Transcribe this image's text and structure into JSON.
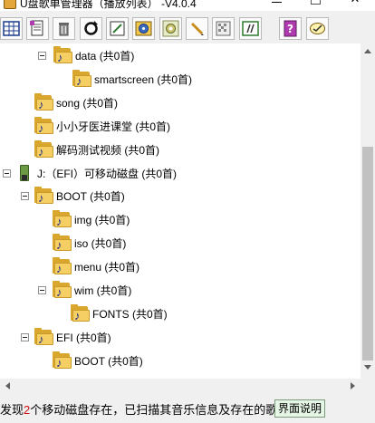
{
  "window": {
    "title": "U盘歌单管理器（播放列表）  -V4.0.4",
    "colors": {
      "folder": "#f5cf63",
      "note": "#1a2c8c",
      "status_highlight": "#d01010",
      "help_button_bg": "#e6f6e6"
    }
  },
  "toolbar": {
    "buttons": [
      {
        "icon": "grid-icon"
      },
      {
        "icon": "playlist-icon"
      },
      {
        "icon": "trash-icon"
      },
      {
        "icon": "refresh-icon"
      },
      {
        "icon": "edit-icon"
      },
      {
        "icon": "disc-icon"
      },
      {
        "icon": "settings-icon"
      },
      {
        "icon": "pen-icon"
      },
      {
        "icon": "pattern-icon"
      },
      {
        "icon": "format-icon"
      },
      {
        "icon": "help-icon"
      },
      {
        "icon": "about-icon"
      }
    ]
  },
  "tree": {
    "items": [
      {
        "label": "data  (共0首)",
        "expanded": true
      },
      {
        "label": "smartscreen  (共0首)"
      },
      {
        "label": "song  (共0首)"
      },
      {
        "label": "小小牙医进课堂  (共0首)"
      },
      {
        "label": "解码测试视频  (共0首)"
      },
      {
        "label": "J:（EFI）可移动磁盘  (共0首)",
        "icon": "usb-drive-icon"
      },
      {
        "label": "BOOT  (共0首)",
        "expanded": true
      },
      {
        "label": "img  (共0首)"
      },
      {
        "label": "iso  (共0首)"
      },
      {
        "label": "menu  (共0首)"
      },
      {
        "label": "wim  (共0首)",
        "expanded": true
      },
      {
        "label": "FONTS  (共0首)"
      },
      {
        "label": "EFI  (共0首)",
        "expanded": true
      },
      {
        "label": "BOOT  (共0首)"
      }
    ]
  },
  "status": {
    "prefix": "发现",
    "count": "2",
    "suffix": "个移动磁盘存在，已扫描其音乐信息及存在的歌单！",
    "help_button": "界面说明"
  }
}
